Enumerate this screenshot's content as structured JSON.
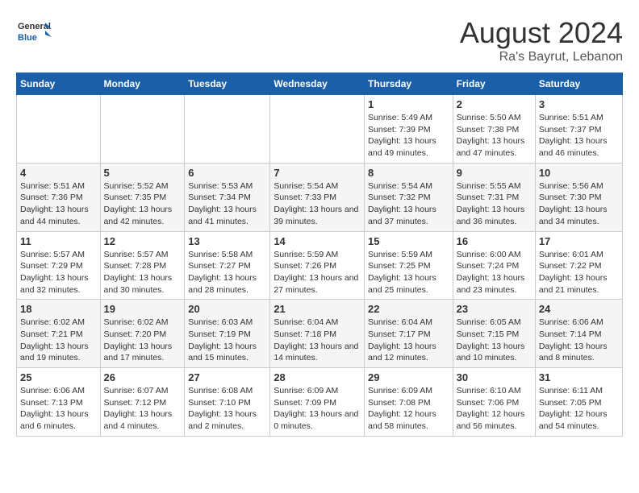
{
  "header": {
    "logo_general": "General",
    "logo_blue": "Blue",
    "month_year": "August 2024",
    "location": "Ra's Bayrut, Lebanon"
  },
  "weekdays": [
    "Sunday",
    "Monday",
    "Tuesday",
    "Wednesday",
    "Thursday",
    "Friday",
    "Saturday"
  ],
  "weeks": [
    [
      {
        "day": "",
        "sunrise": "",
        "sunset": "",
        "daylight": ""
      },
      {
        "day": "",
        "sunrise": "",
        "sunset": "",
        "daylight": ""
      },
      {
        "day": "",
        "sunrise": "",
        "sunset": "",
        "daylight": ""
      },
      {
        "day": "",
        "sunrise": "",
        "sunset": "",
        "daylight": ""
      },
      {
        "day": "1",
        "sunrise": "Sunrise: 5:49 AM",
        "sunset": "Sunset: 7:39 PM",
        "daylight": "Daylight: 13 hours and 49 minutes."
      },
      {
        "day": "2",
        "sunrise": "Sunrise: 5:50 AM",
        "sunset": "Sunset: 7:38 PM",
        "daylight": "Daylight: 13 hours and 47 minutes."
      },
      {
        "day": "3",
        "sunrise": "Sunrise: 5:51 AM",
        "sunset": "Sunset: 7:37 PM",
        "daylight": "Daylight: 13 hours and 46 minutes."
      }
    ],
    [
      {
        "day": "4",
        "sunrise": "Sunrise: 5:51 AM",
        "sunset": "Sunset: 7:36 PM",
        "daylight": "Daylight: 13 hours and 44 minutes."
      },
      {
        "day": "5",
        "sunrise": "Sunrise: 5:52 AM",
        "sunset": "Sunset: 7:35 PM",
        "daylight": "Daylight: 13 hours and 42 minutes."
      },
      {
        "day": "6",
        "sunrise": "Sunrise: 5:53 AM",
        "sunset": "Sunset: 7:34 PM",
        "daylight": "Daylight: 13 hours and 41 minutes."
      },
      {
        "day": "7",
        "sunrise": "Sunrise: 5:54 AM",
        "sunset": "Sunset: 7:33 PM",
        "daylight": "Daylight: 13 hours and 39 minutes."
      },
      {
        "day": "8",
        "sunrise": "Sunrise: 5:54 AM",
        "sunset": "Sunset: 7:32 PM",
        "daylight": "Daylight: 13 hours and 37 minutes."
      },
      {
        "day": "9",
        "sunrise": "Sunrise: 5:55 AM",
        "sunset": "Sunset: 7:31 PM",
        "daylight": "Daylight: 13 hours and 36 minutes."
      },
      {
        "day": "10",
        "sunrise": "Sunrise: 5:56 AM",
        "sunset": "Sunset: 7:30 PM",
        "daylight": "Daylight: 13 hours and 34 minutes."
      }
    ],
    [
      {
        "day": "11",
        "sunrise": "Sunrise: 5:57 AM",
        "sunset": "Sunset: 7:29 PM",
        "daylight": "Daylight: 13 hours and 32 minutes."
      },
      {
        "day": "12",
        "sunrise": "Sunrise: 5:57 AM",
        "sunset": "Sunset: 7:28 PM",
        "daylight": "Daylight: 13 hours and 30 minutes."
      },
      {
        "day": "13",
        "sunrise": "Sunrise: 5:58 AM",
        "sunset": "Sunset: 7:27 PM",
        "daylight": "Daylight: 13 hours and 28 minutes."
      },
      {
        "day": "14",
        "sunrise": "Sunrise: 5:59 AM",
        "sunset": "Sunset: 7:26 PM",
        "daylight": "Daylight: 13 hours and 27 minutes."
      },
      {
        "day": "15",
        "sunrise": "Sunrise: 5:59 AM",
        "sunset": "Sunset: 7:25 PM",
        "daylight": "Daylight: 13 hours and 25 minutes."
      },
      {
        "day": "16",
        "sunrise": "Sunrise: 6:00 AM",
        "sunset": "Sunset: 7:24 PM",
        "daylight": "Daylight: 13 hours and 23 minutes."
      },
      {
        "day": "17",
        "sunrise": "Sunrise: 6:01 AM",
        "sunset": "Sunset: 7:22 PM",
        "daylight": "Daylight: 13 hours and 21 minutes."
      }
    ],
    [
      {
        "day": "18",
        "sunrise": "Sunrise: 6:02 AM",
        "sunset": "Sunset: 7:21 PM",
        "daylight": "Daylight: 13 hours and 19 minutes."
      },
      {
        "day": "19",
        "sunrise": "Sunrise: 6:02 AM",
        "sunset": "Sunset: 7:20 PM",
        "daylight": "Daylight: 13 hours and 17 minutes."
      },
      {
        "day": "20",
        "sunrise": "Sunrise: 6:03 AM",
        "sunset": "Sunset: 7:19 PM",
        "daylight": "Daylight: 13 hours and 15 minutes."
      },
      {
        "day": "21",
        "sunrise": "Sunrise: 6:04 AM",
        "sunset": "Sunset: 7:18 PM",
        "daylight": "Daylight: 13 hours and 14 minutes."
      },
      {
        "day": "22",
        "sunrise": "Sunrise: 6:04 AM",
        "sunset": "Sunset: 7:17 PM",
        "daylight": "Daylight: 13 hours and 12 minutes."
      },
      {
        "day": "23",
        "sunrise": "Sunrise: 6:05 AM",
        "sunset": "Sunset: 7:15 PM",
        "daylight": "Daylight: 13 hours and 10 minutes."
      },
      {
        "day": "24",
        "sunrise": "Sunrise: 6:06 AM",
        "sunset": "Sunset: 7:14 PM",
        "daylight": "Daylight: 13 hours and 8 minutes."
      }
    ],
    [
      {
        "day": "25",
        "sunrise": "Sunrise: 6:06 AM",
        "sunset": "Sunset: 7:13 PM",
        "daylight": "Daylight: 13 hours and 6 minutes."
      },
      {
        "day": "26",
        "sunrise": "Sunrise: 6:07 AM",
        "sunset": "Sunset: 7:12 PM",
        "daylight": "Daylight: 13 hours and 4 minutes."
      },
      {
        "day": "27",
        "sunrise": "Sunrise: 6:08 AM",
        "sunset": "Sunset: 7:10 PM",
        "daylight": "Daylight: 13 hours and 2 minutes."
      },
      {
        "day": "28",
        "sunrise": "Sunrise: 6:09 AM",
        "sunset": "Sunset: 7:09 PM",
        "daylight": "Daylight: 13 hours and 0 minutes."
      },
      {
        "day": "29",
        "sunrise": "Sunrise: 6:09 AM",
        "sunset": "Sunset: 7:08 PM",
        "daylight": "Daylight: 12 hours and 58 minutes."
      },
      {
        "day": "30",
        "sunrise": "Sunrise: 6:10 AM",
        "sunset": "Sunset: 7:06 PM",
        "daylight": "Daylight: 12 hours and 56 minutes."
      },
      {
        "day": "31",
        "sunrise": "Sunrise: 6:11 AM",
        "sunset": "Sunset: 7:05 PM",
        "daylight": "Daylight: 12 hours and 54 minutes."
      }
    ]
  ]
}
